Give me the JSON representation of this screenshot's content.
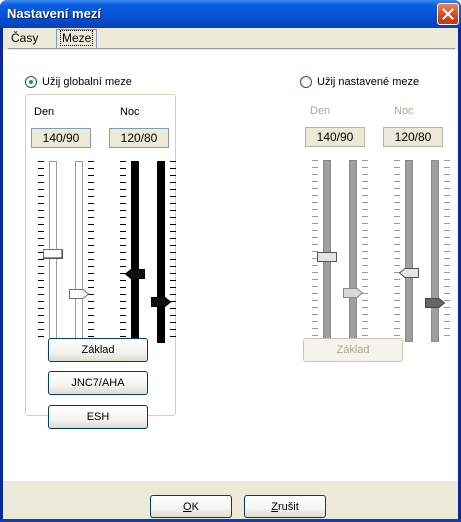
{
  "window": {
    "title": "Nastavení mezí"
  },
  "tabs": [
    {
      "label": "Časy",
      "active": false
    },
    {
      "label": "Meze",
      "active": true
    }
  ],
  "global": {
    "radio_label": "Užij globalní meze",
    "checked": true,
    "day_label": "Den",
    "night_label": "Noc",
    "day_value": "140/90",
    "night_value": "120/80",
    "buttons": [
      "Základ",
      "JNC7/AHA",
      "ESH"
    ]
  },
  "custom": {
    "radio_label": "Užij nastavené meze",
    "checked": false,
    "day_label": "Den",
    "night_label": "Noc",
    "day_value": "140/90",
    "night_value": "120/80",
    "button": "Základ"
  },
  "footer": {
    "ok_label": "OK",
    "ok_accel": "O",
    "ok_rest": "K",
    "cancel_label": "Zrušit",
    "cancel_accel": "Z",
    "cancel_rest": "rušit"
  },
  "colors": {
    "title_bar": "#0753d8",
    "close_button": "#d6451a",
    "dialog_bg": "#ece9d8",
    "panel_bg": "#ffffff"
  }
}
